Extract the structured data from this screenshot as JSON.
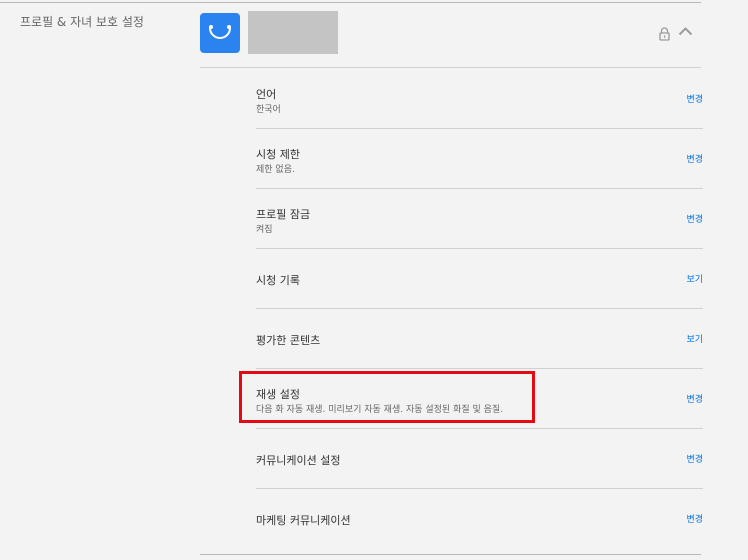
{
  "section": {
    "title": "프로필 & 자녀 보호 설정"
  },
  "profile": {
    "avatar_icon": "smiley-avatar-icon",
    "lock_icon": "lock-icon",
    "collapse_icon": "chevron-up-icon"
  },
  "rows": [
    {
      "title": "언어",
      "subtitle": "한국어",
      "action": "변경"
    },
    {
      "title": "시청 제한",
      "subtitle": "제한 없음.",
      "action": "변경"
    },
    {
      "title": "프로필 잠금",
      "subtitle": "켜짐",
      "action": "변경"
    },
    {
      "title": "시청 기록",
      "subtitle": "",
      "action": "보기"
    },
    {
      "title": "평가한 콘텐츠",
      "subtitle": "",
      "action": "보기"
    },
    {
      "title": "재생 설정",
      "subtitle": "다음 화 자동 재생. 미리보기 자동 재생. 자동 설정된 화질 및 음질.",
      "action": "변경"
    },
    {
      "title": "커뮤니케이션 설정",
      "subtitle": "",
      "action": "변경"
    },
    {
      "title": "마케팅 커뮤니케이션",
      "subtitle": "",
      "action": "변경"
    }
  ],
  "colors": {
    "accent_link": "#0073e6",
    "highlight": "#e50914",
    "avatar": "#2b83f0"
  }
}
